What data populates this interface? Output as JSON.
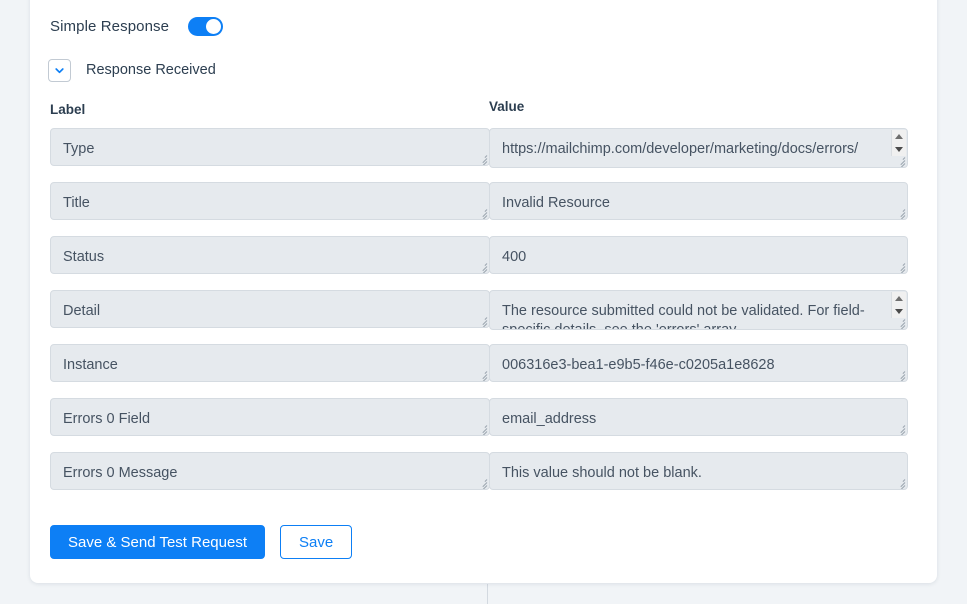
{
  "panel": {
    "simple_response_label": "Simple Response",
    "toggle_state": "on",
    "collapse_label": "Response Received",
    "collapse_icon": "chevron-down-icon",
    "accent_color": "#0d7ff5",
    "field_bg_color": "#e6eaee",
    "card_bg_color": "#ffffff",
    "page_bg_color": "#f1f4f7"
  },
  "columns": {
    "label_header": "Label",
    "value_header": "Value"
  },
  "rows": [
    {
      "label": "Type",
      "value": "https://mailchimp.com/developer/marketing/docs/errors/",
      "scrollable": true
    },
    {
      "label": "Title",
      "value": "Invalid Resource",
      "scrollable": false
    },
    {
      "label": "Status",
      "value": "400",
      "scrollable": false
    },
    {
      "label": "Detail",
      "value": "The resource submitted could not be validated. For field-specific details, see the 'errors' array.",
      "scrollable": true
    },
    {
      "label": "Instance",
      "value": "006316e3-bea1-e9b5-f46e-c0205a1e8628",
      "scrollable": false
    },
    {
      "label": "Errors 0 Field",
      "value": "email_address",
      "scrollable": false
    },
    {
      "label": "Errors 0 Message",
      "value": "This value should not be blank.",
      "scrollable": false
    }
  ],
  "buttons": {
    "primary_label": "Save & Send Test Request",
    "secondary_label": "Save"
  }
}
